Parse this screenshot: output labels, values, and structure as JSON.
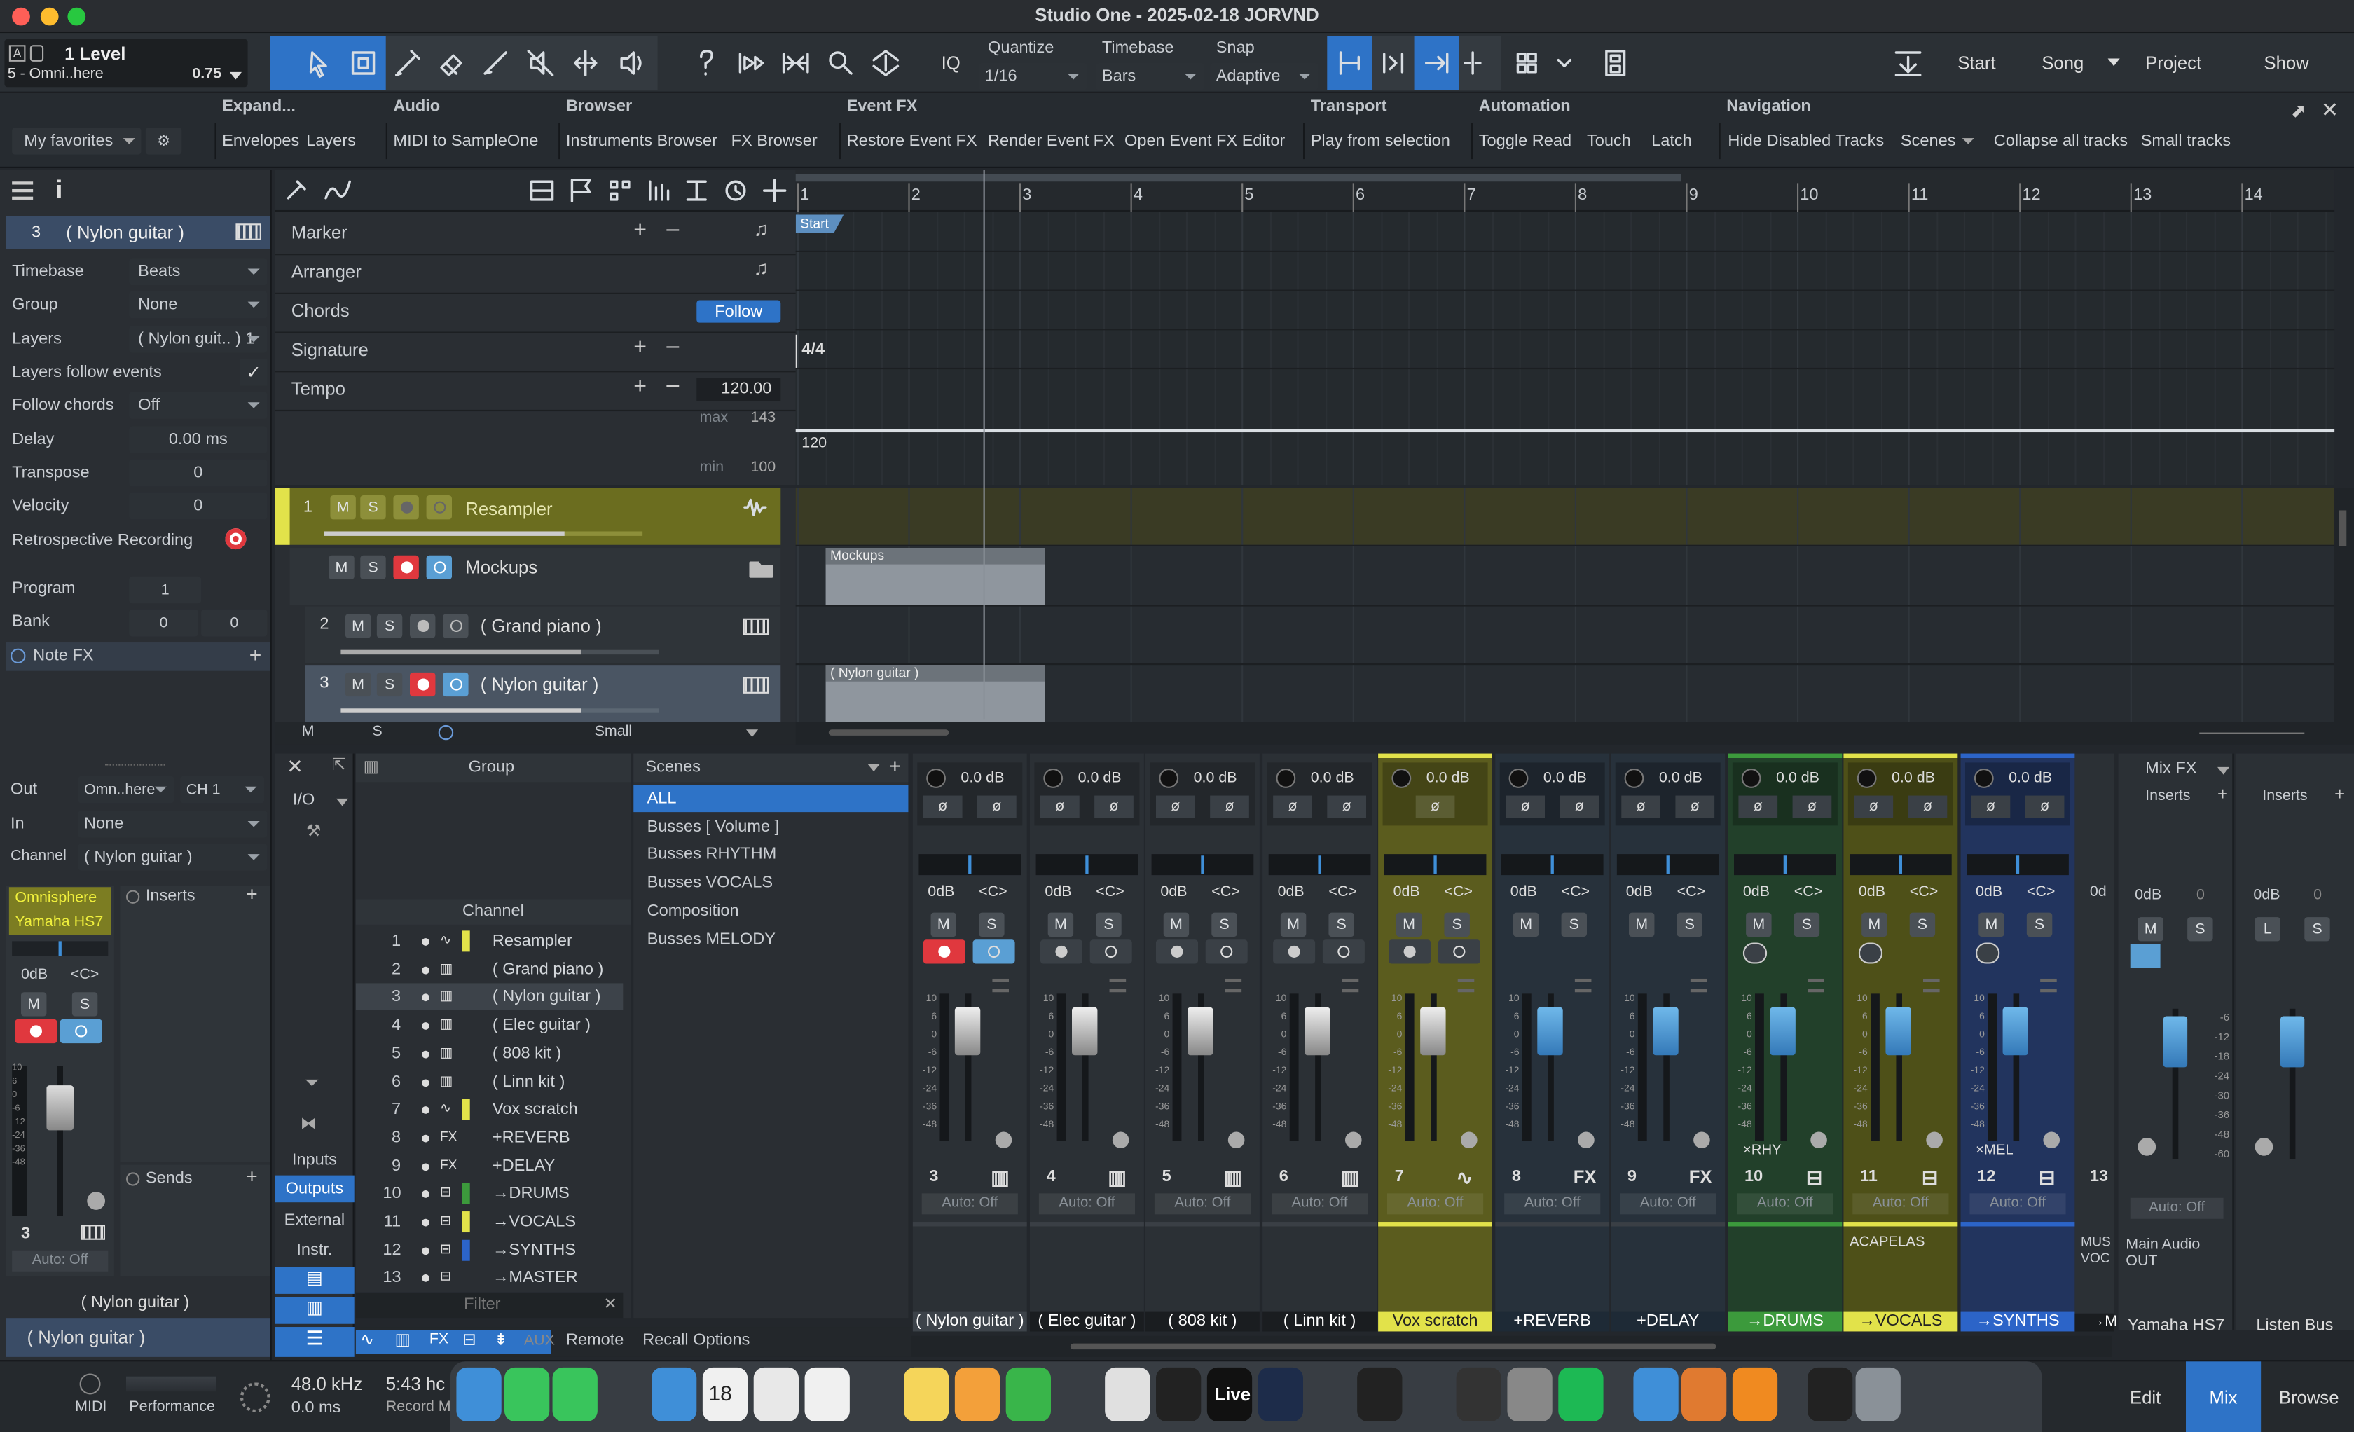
{
  "window": {
    "title": "Studio One - 2025-02-18 JORVND"
  },
  "colors": {
    "accent": "#3f8fd8",
    "olive": "#7c7d22",
    "yellow": "#e2e24a",
    "green": "#3c9a3c",
    "blue": "#2c64c8",
    "record": "#e0383e"
  },
  "level": {
    "title": "1 Level",
    "subtitle": "5 - Omni..here",
    "value": "0.75"
  },
  "toolbar": {
    "quantize_label": "Quantize",
    "quantize_value": "1/16",
    "timebase_label": "Timebase",
    "timebase_value": "Bars",
    "snap_label": "Snap",
    "snap_value": "Adaptive",
    "iq": "IQ",
    "start": "Start",
    "song": "Song",
    "project": "Project",
    "show": "Show",
    "tools": [
      "arrow-tool-icon",
      "range-tool-icon",
      "pencil-tool-icon",
      "eraser-tool-icon",
      "paint-tool-icon",
      "mute-tool-icon",
      "split-tool-icon",
      "listen-tool-icon",
      "help-icon",
      "ripple-icon",
      "bend-icon",
      "zoom-icon",
      "autoscroll-icon"
    ]
  },
  "macro": {
    "groups": [
      {
        "title": "Expand...",
        "items": [
          "Envelopes",
          "Layers"
        ]
      },
      {
        "title": "Audio",
        "items": [
          "MIDI to SampleOne"
        ]
      },
      {
        "title": "Browser",
        "items": [
          "Instruments Browser",
          "FX Browser"
        ]
      },
      {
        "title": "Event FX",
        "items": [
          "Restore Event FX",
          "Render Event FX",
          "Open Event FX Editor"
        ]
      },
      {
        "title": "Transport",
        "items": [
          "Play from selection"
        ]
      },
      {
        "title": "Automation",
        "items": [
          "Toggle Read",
          "Touch",
          "Latch"
        ]
      },
      {
        "title": "Navigation",
        "items": [
          "Hide Disabled Tracks",
          "Scenes",
          "Collapse all tracks",
          "Small tracks"
        ]
      }
    ],
    "favorites": "My favorites"
  },
  "inspector": {
    "track_num": "3",
    "track_name": "( Nylon guitar )",
    "rows": [
      {
        "label": "Timebase",
        "value": "Beats"
      },
      {
        "label": "Group",
        "value": "None"
      },
      {
        "label": "Layers",
        "value": "( Nylon guit.. ) 1"
      },
      {
        "label": "Layers follow events",
        "value": "✓"
      },
      {
        "label": "Follow chords",
        "value": "Off"
      },
      {
        "label": "Delay",
        "value": "0.00 ms"
      },
      {
        "label": "Transpose",
        "value": "0"
      },
      {
        "label": "Velocity",
        "value": "0"
      },
      {
        "label": "Retrospective Recording",
        "value": ""
      }
    ],
    "program_label": "Program",
    "program": "1",
    "bank_label": "Bank",
    "bank_a": "0",
    "bank_b": "0",
    "notefx": "Note FX",
    "out_label": "Out",
    "out_value": "Omn..here",
    "out_ch": "CH 1",
    "in_label": "In",
    "in_value": "None",
    "channel_label": "Channel",
    "channel_value": "( Nylon guitar )",
    "plugin1": "Omnisphere",
    "plugin2": "Yamaha HS7",
    "inserts": "Inserts",
    "sends": "Sends",
    "db": "0dB",
    "pan": "<C>",
    "m": "M",
    "s": "S",
    "num": "3",
    "auto": "Auto: Off",
    "footer_name": "( Nylon guitar )",
    "bottom_name": "( Nylon guitar )"
  },
  "globaltracks": {
    "rows": [
      "Marker",
      "Arranger",
      "Chords",
      "Signature",
      "Tempo"
    ],
    "follow": "Follow",
    "tempo": "120.00",
    "max_label": "max",
    "max": "143",
    "min_label": "min",
    "min": "100",
    "sig": "4/4",
    "tempo_line": "120",
    "start": "Start"
  },
  "ruler": [
    "1",
    "2",
    "3",
    "4",
    "5",
    "6",
    "7",
    "8",
    "9",
    "10",
    "11",
    "12",
    "13",
    "14"
  ],
  "tracks": [
    {
      "num": "1",
      "name": "Resampler",
      "icon": "waveform-icon"
    },
    {
      "num": "",
      "name": "Mockups",
      "icon": "folder-icon"
    },
    {
      "num": "2",
      "name": "( Grand piano )",
      "icon": "piano-icon"
    },
    {
      "num": "3",
      "name": "( Nylon guitar )",
      "icon": "piano-icon"
    }
  ],
  "events": [
    {
      "name": "Mockups"
    },
    {
      "name": "( Nylon guitar )"
    }
  ],
  "trackfooter": {
    "m": "M",
    "s": "S",
    "size": "Small"
  },
  "mixer": {
    "group": "Group",
    "io": "I/O",
    "channel_header": "Channel",
    "channels": [
      {
        "n": "1",
        "name": "Resampler"
      },
      {
        "n": "2",
        "name": "( Grand piano )"
      },
      {
        "n": "3",
        "name": "( Nylon guitar )"
      },
      {
        "n": "4",
        "name": "( Elec guitar )"
      },
      {
        "n": "5",
        "name": "( 808 kit )"
      },
      {
        "n": "6",
        "name": "( Linn kit )"
      },
      {
        "n": "7",
        "name": "Vox scratch"
      },
      {
        "n": "8",
        "name": "+REVERB"
      },
      {
        "n": "9",
        "name": "+DELAY"
      },
      {
        "n": "10",
        "name": "→DRUMS"
      },
      {
        "n": "11",
        "name": "→VOCALS"
      },
      {
        "n": "12",
        "name": "→SYNTHS"
      },
      {
        "n": "13",
        "name": "→MASTER"
      }
    ],
    "filter": "Filter",
    "scenes_title": "Scenes",
    "scenes": [
      "ALL",
      "Busses [ Volume ]",
      "Busses RHYTHM",
      "Busses VOCALS",
      "Composition",
      "Busses MELODY"
    ],
    "inputs": "Inputs",
    "outputs": "Outputs",
    "external": "External",
    "instr": "Instr.",
    "aux": "AUX",
    "remote": "Remote",
    "recall": "Recall Options",
    "mixfx": "Mix FX",
    "inserts": "Inserts"
  },
  "strips": [
    {
      "num": "3",
      "name": "( Nylon guitar )",
      "gain": "0.0 dB",
      "db": "0dB",
      "pan": "<C>",
      "auto": "Auto: Off",
      "tag": "",
      "label": ""
    },
    {
      "num": "4",
      "name": "( Elec guitar )",
      "gain": "0.0 dB",
      "db": "0dB",
      "pan": "<C>",
      "auto": "Auto: Off",
      "tag": "",
      "label": ""
    },
    {
      "num": "5",
      "name": "( 808 kit )",
      "gain": "0.0 dB",
      "db": "0dB",
      "pan": "<C>",
      "auto": "Auto: Off",
      "tag": "",
      "label": ""
    },
    {
      "num": "6",
      "name": "( Linn kit )",
      "gain": "0.0 dB",
      "db": "0dB",
      "pan": "<C>",
      "auto": "Auto: Off",
      "tag": "",
      "label": ""
    },
    {
      "num": "7",
      "name": "Vox scratch",
      "gain": "0.0 dB",
      "db": "0dB",
      "pan": "<C>",
      "auto": "Auto: Off",
      "tag": "",
      "label": ""
    },
    {
      "num": "8",
      "name": "+REVERB",
      "gain": "0.0 dB",
      "db": "0dB",
      "pan": "<C>",
      "auto": "Auto: Off",
      "tag": "FX",
      "label": ""
    },
    {
      "num": "9",
      "name": "+DELAY",
      "gain": "0.0 dB",
      "db": "0dB",
      "pan": "<C>",
      "auto": "Auto: Off",
      "tag": "FX",
      "label": ""
    },
    {
      "num": "10",
      "name": "→DRUMS",
      "gain": "0.0 dB",
      "db": "0dB",
      "pan": "<C>",
      "auto": "Auto: Off",
      "tag": "×RHY",
      "label": ""
    },
    {
      "num": "11",
      "name": "→VOCALS",
      "gain": "0.0 dB",
      "db": "0dB",
      "pan": "<C>",
      "auto": "Auto: Off",
      "tag": "",
      "label": "ACAPELAS"
    },
    {
      "num": "12",
      "name": "→SYNTHS",
      "gain": "0.0 dB",
      "db": "0dB",
      "pan": "<C>",
      "auto": "Auto: Off",
      "tag": "×MEL",
      "label": ""
    }
  ],
  "partial": {
    "num": "13",
    "db": "0d",
    "name": "→M",
    "label": "MUS VOC"
  },
  "scale": [
    "10",
    "6",
    "0",
    "-6",
    "-12",
    "-24",
    "-36",
    "-48"
  ],
  "main": {
    "name": "Yamaha HS7",
    "label": "Main Audio OUT",
    "db": "0dB",
    "val": "0",
    "auto": "Auto: Off",
    "scale": [
      "-6",
      "-12",
      "-18",
      "-24",
      "-30",
      "-36",
      "-48",
      "-60"
    ]
  },
  "listen": {
    "name": "Listen Bus",
    "db": "0dB",
    "val": "0"
  },
  "status": {
    "midi": "MIDI",
    "performance": "Performance",
    "rate": "48.0 kHz",
    "latency": "0.0 ms",
    "time": "5:43 hc",
    "record": "Record M"
  },
  "views": {
    "edit": "Edit",
    "mix": "Mix",
    "browse": "Browse"
  },
  "ms_labels": {
    "m": "M",
    "s": "S"
  }
}
